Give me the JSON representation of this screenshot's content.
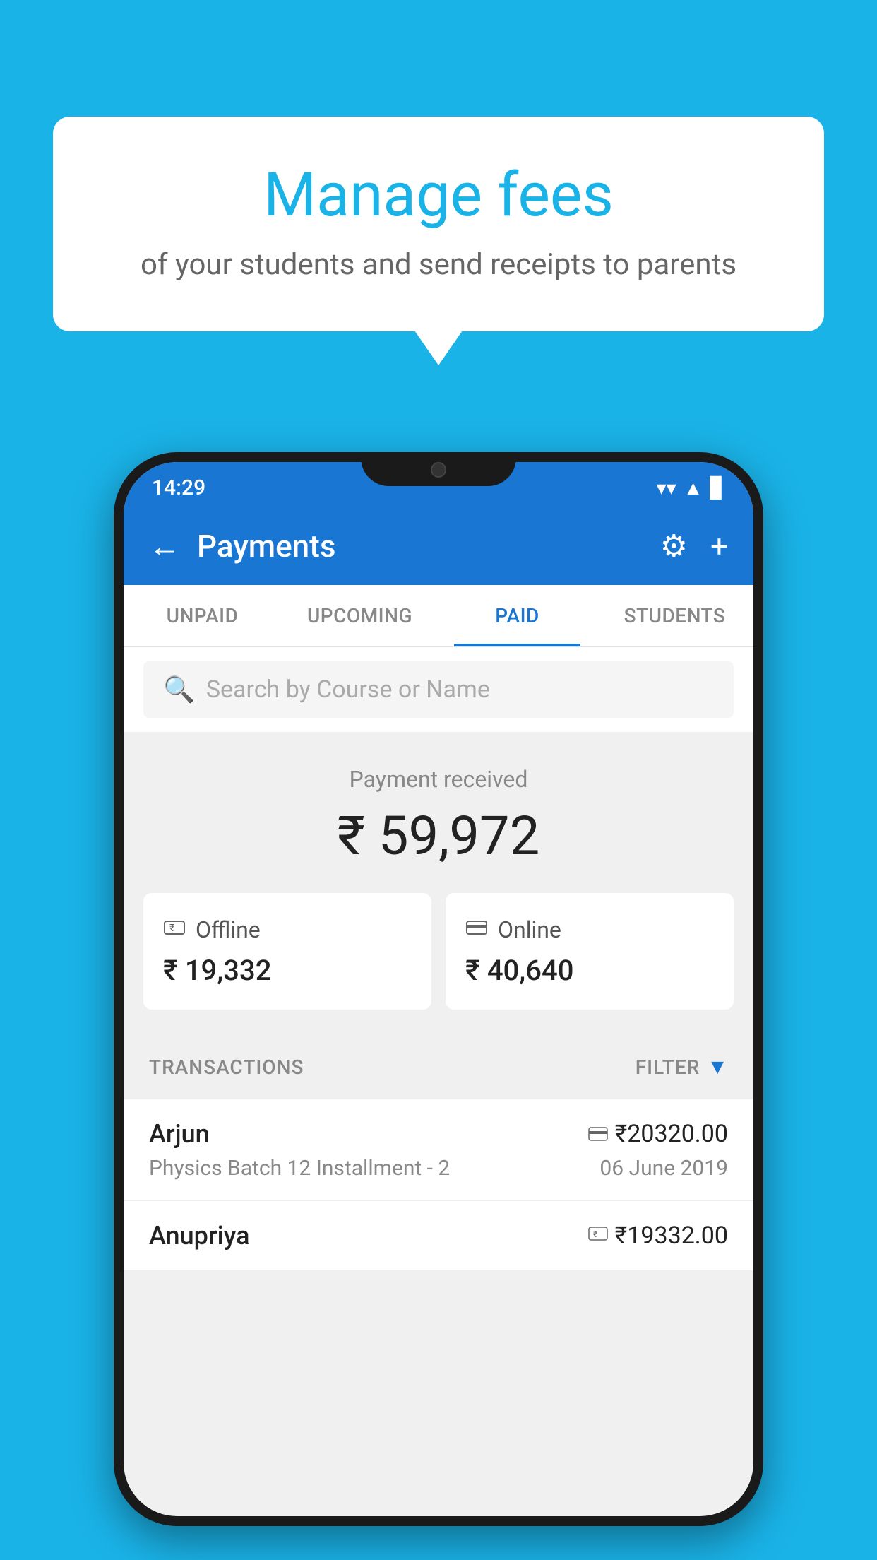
{
  "background_color": "#1ab3e8",
  "speech_bubble": {
    "title": "Manage fees",
    "subtitle": "of your students and send receipts to parents"
  },
  "status_bar": {
    "time": "14:29",
    "wifi": "▲",
    "signal": "▲",
    "battery": "▊"
  },
  "app_bar": {
    "title": "Payments",
    "back_label": "←",
    "gear_label": "⚙",
    "plus_label": "+"
  },
  "tabs": [
    {
      "label": "UNPAID",
      "active": false
    },
    {
      "label": "UPCOMING",
      "active": false
    },
    {
      "label": "PAID",
      "active": true
    },
    {
      "label": "STUDENTS",
      "active": false
    }
  ],
  "search": {
    "placeholder": "Search by Course or Name"
  },
  "payment_received": {
    "label": "Payment received",
    "amount": "₹ 59,972"
  },
  "payment_cards": [
    {
      "icon": "offline",
      "label": "Offline",
      "amount": "₹ 19,332"
    },
    {
      "icon": "online",
      "label": "Online",
      "amount": "₹ 40,640"
    }
  ],
  "transactions": {
    "label": "TRANSACTIONS",
    "filter_label": "FILTER"
  },
  "transaction_list": [
    {
      "name": "Arjun",
      "payment_method": "card",
      "amount": "₹20320.00",
      "course": "Physics Batch 12 Installment - 2",
      "date": "06 June 2019"
    },
    {
      "name": "Anupriya",
      "payment_method": "offline",
      "amount": "₹19332.00",
      "course": "",
      "date": ""
    }
  ]
}
